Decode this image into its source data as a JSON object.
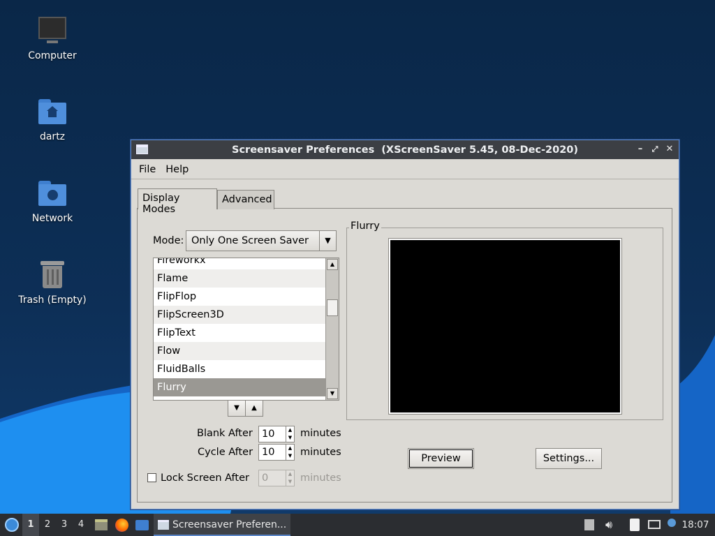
{
  "desktop": {
    "icons": [
      {
        "label": "Computer",
        "icon": "computer-icon"
      },
      {
        "label": "dartz",
        "icon": "home-folder-icon"
      },
      {
        "label": "Network",
        "icon": "network-folder-icon"
      },
      {
        "label": "Trash (Empty)",
        "icon": "trash-icon"
      }
    ]
  },
  "window": {
    "title": "Screensaver Preferences  (XScreenSaver 5.45, 08-Dec-2020)",
    "menu": {
      "file": "File",
      "help": "Help"
    },
    "tabs": {
      "display_modes": "Display Modes",
      "advanced": "Advanced"
    },
    "mode": {
      "label": "Mode:",
      "value": "Only One Screen Saver"
    },
    "saver_list": {
      "items": [
        "Fireworkx",
        "Flame",
        "FlipFlop",
        "FlipScreen3D",
        "FlipText",
        "Flow",
        "FluidBalls",
        "Flurry"
      ],
      "selected": "Flurry"
    },
    "blank_after": {
      "label": "Blank After",
      "value": "10",
      "unit": "minutes"
    },
    "cycle_after": {
      "label": "Cycle After",
      "value": "10",
      "unit": "minutes"
    },
    "lock_screen": {
      "label": "Lock Screen After",
      "value": "0",
      "unit": "minutes",
      "checked": false
    },
    "preview_group": {
      "label": "Flurry"
    },
    "buttons": {
      "preview": "Preview",
      "settings": "Settings..."
    }
  },
  "taskbar": {
    "workspaces": [
      "1",
      "2",
      "3",
      "4"
    ],
    "active_workspace": "1",
    "task_label": "Screensaver Preferen...",
    "clock": "18:07"
  },
  "colors": {
    "desktop_bg": "#0b2a4f",
    "wave_light": "#1e8ff0",
    "wave_dark": "#1565c6",
    "window_bg": "#dcdad5",
    "titlebar": "#3c3f44",
    "taskbar": "#2b2d31",
    "folder_blue": "#4f8fdc"
  }
}
